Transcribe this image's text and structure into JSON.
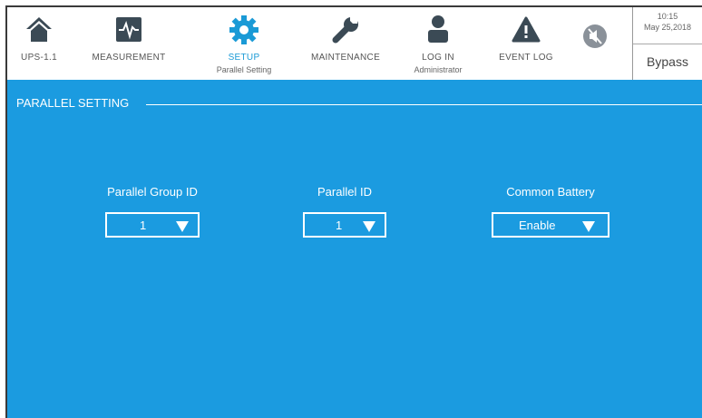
{
  "nav": {
    "ups": {
      "label": "UPS-1.1"
    },
    "measurement": {
      "label": "MEASUREMENT"
    },
    "setup": {
      "label": "SETUP",
      "sub": "Parallel Setting"
    },
    "maintenance": {
      "label": "MAINTENANCE"
    },
    "login": {
      "label": "LOG IN",
      "sub": "Administrator"
    },
    "eventlog": {
      "label": "EVENT LOG"
    }
  },
  "status": {
    "time": "10:15",
    "date": "May 25,2018",
    "mode": "Bypass"
  },
  "section": {
    "title": "PARALLEL SETTING"
  },
  "fields": {
    "group_id": {
      "label": "Parallel Group ID",
      "value": "1"
    },
    "parallel_id": {
      "label": "Parallel ID",
      "value": "1"
    },
    "common_battery": {
      "label": "Common Battery",
      "value": "Enable"
    }
  },
  "colors": {
    "accent": "#1b9be0",
    "icon": "#3b4a55",
    "active": "#1a9ad6"
  }
}
